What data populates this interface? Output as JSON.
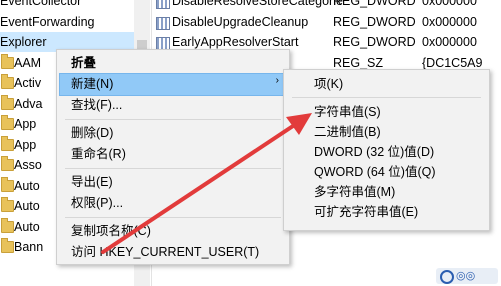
{
  "tree": {
    "items": [
      {
        "label": "EventCollector",
        "folder": false
      },
      {
        "label": "EventForwarding",
        "folder": false
      },
      {
        "label": "Explorer",
        "folder": false,
        "selected": true
      },
      {
        "label": "AAM",
        "folder": true
      },
      {
        "label": "Activ",
        "folder": true
      },
      {
        "label": "Adva",
        "folder": true
      },
      {
        "label": "App",
        "folder": true
      },
      {
        "label": "App",
        "folder": true
      },
      {
        "label": "Asso",
        "folder": true
      },
      {
        "label": "Auto",
        "folder": true
      },
      {
        "label": "Auto",
        "folder": true
      },
      {
        "label": "Auto",
        "folder": true
      },
      {
        "label": "Bann",
        "folder": true
      }
    ]
  },
  "values": {
    "rows": [
      {
        "name": "DisableResolveStoreCategorie",
        "type": "REG_DWORD",
        "data": "0x000000"
      },
      {
        "name": "DisableUpgradeCleanup",
        "type": "REG_DWORD",
        "data": "0x000000"
      },
      {
        "name": "EarlyAppResolverStart",
        "type": "REG_DWORD",
        "data": "0x000000"
      },
      {
        "name": "",
        "type": "REG_SZ",
        "data": "{DC1C5A9"
      },
      {
        "name": "",
        "type": "",
        "data": "0ea"
      },
      {
        "name": "",
        "type": "",
        "data": "00"
      },
      {
        "name": "",
        "type": "",
        "data": "D2D"
      },
      {
        "name": "",
        "type": "",
        "data": "00"
      },
      {
        "name": "",
        "type": "",
        "data": "f5ea"
      },
      {
        "name": "",
        "type": "",
        "data": "0c8"
      },
      {
        "name": "",
        "type": "",
        "data": "00"
      },
      {
        "name": "",
        "type": "",
        "data": "00"
      }
    ]
  },
  "context_menu": {
    "items": [
      {
        "label": "折叠",
        "bold": true
      },
      {
        "label": "新建(N)",
        "submenu": true,
        "highlighted": true
      },
      {
        "label": "查找(F)..."
      },
      {
        "separator": true
      },
      {
        "label": "删除(D)"
      },
      {
        "label": "重命名(R)"
      },
      {
        "separator": true
      },
      {
        "label": "导出(E)"
      },
      {
        "label": "权限(P)..."
      },
      {
        "separator": true
      },
      {
        "label": "复制项名称(C)"
      },
      {
        "label": "访问 HKEY_CURRENT_USER(T)"
      }
    ],
    "submenu_arrow": "›"
  },
  "submenu": {
    "items": [
      {
        "label": "项(K)"
      },
      {
        "separator": true
      },
      {
        "label": "字符串值(S)"
      },
      {
        "label": "二进制值(B)"
      },
      {
        "label": "DWORD (32 位)值(D)"
      },
      {
        "label": "QWORD (64 位)值(Q)"
      },
      {
        "label": "多字符串值(M)"
      },
      {
        "label": "可扩充字符串值(E)"
      }
    ]
  },
  "colors": {
    "highlight": "#91c9f7",
    "arrow": "#e23b3b",
    "tree_selected": "#cce8ff"
  }
}
